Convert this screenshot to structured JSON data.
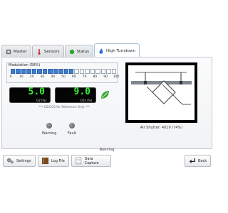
{
  "tabs": [
    {
      "label": "Master",
      "icon": "wrench-icon"
    },
    {
      "label": "Sensors",
      "icon": "thermometer-icon"
    },
    {
      "label": "Status",
      "icon": "status-dot-icon"
    },
    {
      "label": "High Turndown",
      "icon": "flame-icon",
      "active": true
    }
  ],
  "modulation": {
    "title": "Modulation (58%)",
    "percent": 58,
    "ticks": [
      "0",
      "10",
      "20",
      "30",
      "40",
      "50",
      "60",
      "70",
      "80",
      "90",
      "100"
    ]
  },
  "o2": {
    "value": "5.0",
    "unit": "O2 (%)"
  },
  "co2": {
    "value": "9.0",
    "unit": "CO2 (%)"
  },
  "note": "*** O2/CO2 for Reference Only ***",
  "indicators": {
    "warning": "Warning",
    "fault": "Fault"
  },
  "shutter": {
    "label": "Air Shutter: 4019 (74%)"
  },
  "status": "Running",
  "buttons": {
    "settings": "Settings",
    "log": "Log File",
    "capture": "Data Capture",
    "back": "Back"
  },
  "colors": {
    "accent": "#3f7ed1",
    "lcd_text": "#35f035",
    "status_green": "#2fa32f"
  }
}
